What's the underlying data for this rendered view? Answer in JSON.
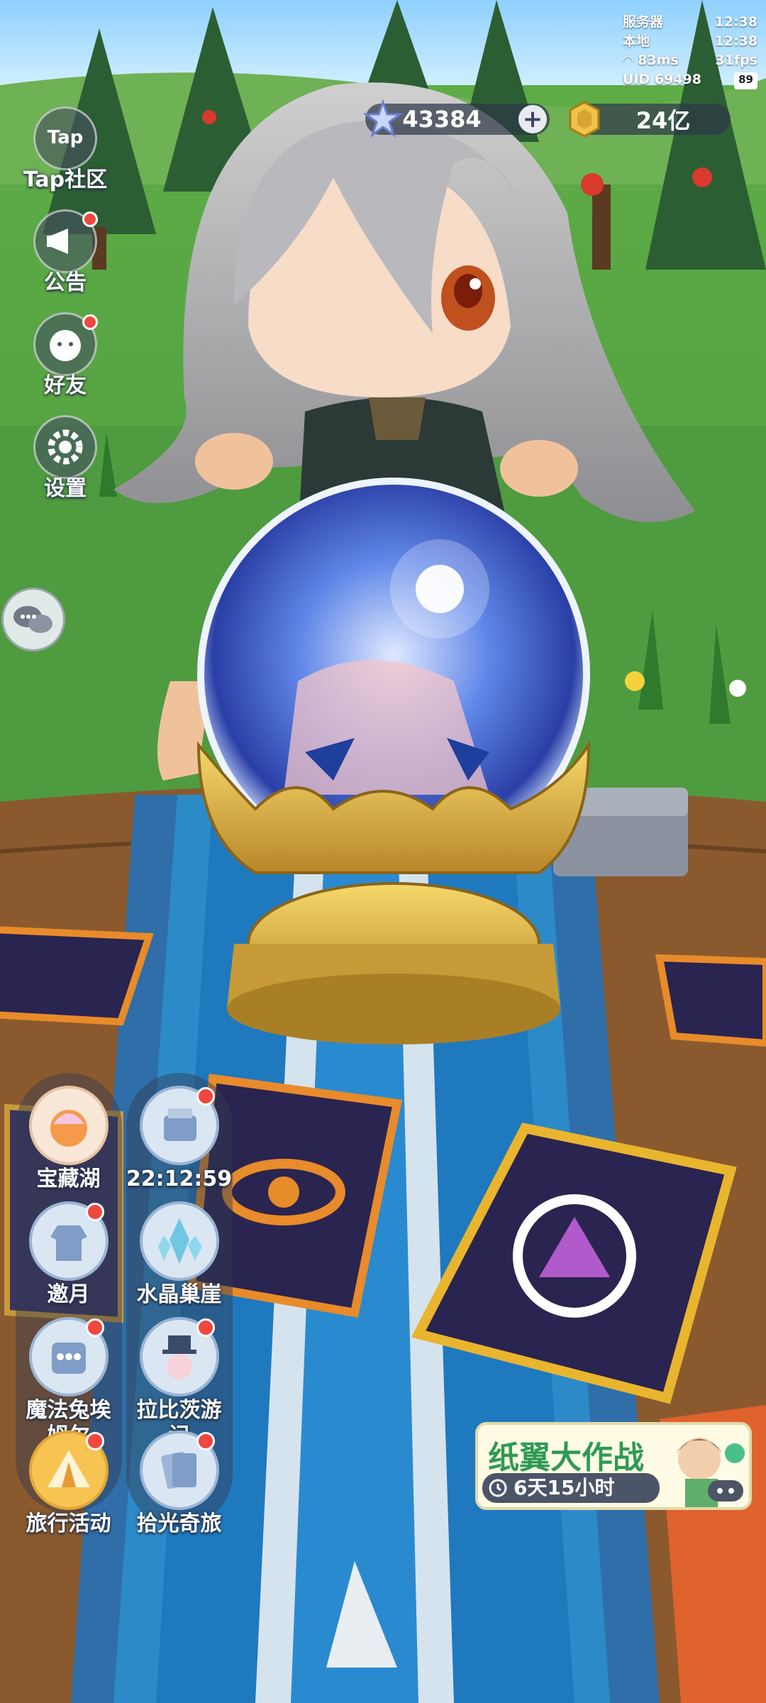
{
  "status": {
    "server_label": "服务器",
    "server_time": "12:38",
    "local_label": "本地",
    "local_time": "12:38",
    "ping": "83ms",
    "fps": "31fps",
    "uid": "UID 69498",
    "battery": "89"
  },
  "currency": {
    "stars": "43384",
    "coins": "24亿"
  },
  "left_menu": [
    {
      "label": "Tap社区",
      "icon": "tap-icon"
    },
    {
      "label": "公告",
      "icon": "megaphone-icon"
    },
    {
      "label": "好友",
      "icon": "pet-face-icon"
    },
    {
      "label": "设置",
      "icon": "gear-icon"
    }
  ],
  "activities": [
    {
      "label": "宝藏湖",
      "icon": "treasure-shell-icon"
    },
    {
      "label": "22:12:59",
      "icon": "shop-cart-icon"
    },
    {
      "label": "邀月",
      "icon": "jacket-icon"
    },
    {
      "label": "水晶巢崖",
      "icon": "crystal-icon"
    },
    {
      "label": "魔法兔埃姆尔",
      "icon": "bunny-machine-icon"
    },
    {
      "label": "拉比茨游记",
      "icon": "rabbit-hat-icon"
    },
    {
      "label": "旅行活动",
      "icon": "tent-icon"
    },
    {
      "label": "拾光奇旅",
      "icon": "card-deck-icon"
    }
  ],
  "banner": {
    "title": "纸翼大作战",
    "timer": "6天15小时"
  },
  "colors": {
    "badge_red": "#f0473f",
    "banner_green": "#2f9a53"
  }
}
